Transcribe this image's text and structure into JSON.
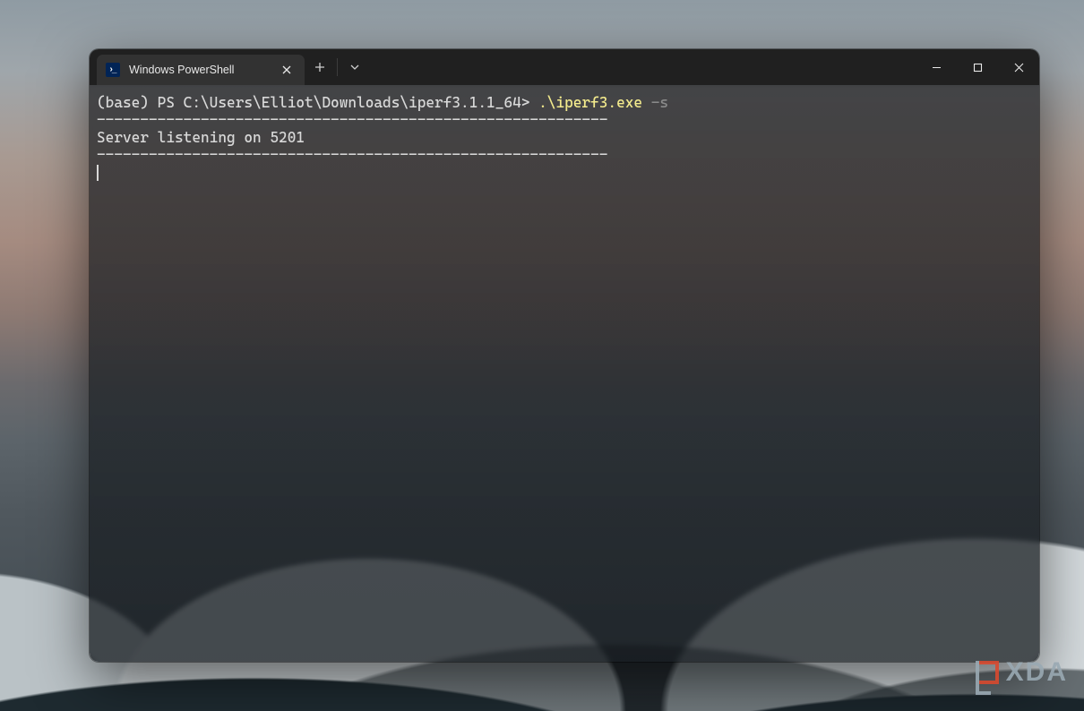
{
  "tab": {
    "title": "Windows PowerShell"
  },
  "terminal": {
    "prompt": "(base) PS C:\\Users\\Elliot\\Downloads\\iperf3.1.1_64> ",
    "command": ".\\iperf3.exe",
    "flag": " -s",
    "sep": "-----------------------------------------------------------",
    "listening": "Server listening on 5201"
  },
  "watermark": {
    "text": "XDA"
  }
}
